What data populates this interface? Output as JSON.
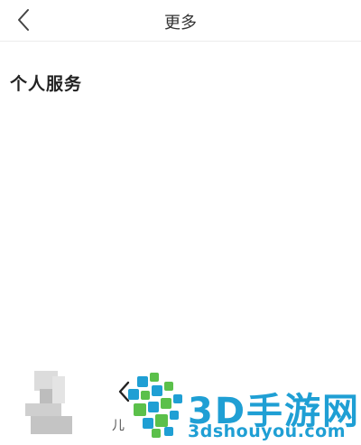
{
  "navbar": {
    "title": "更多",
    "back_icon": "chevron-left-icon"
  },
  "section": {
    "title": "个人服务"
  },
  "bottom_bar": {
    "partial_label": "儿",
    "partial_icon": "chevron-left-icon"
  },
  "watermark": {
    "brand": "3D手游网",
    "url": "3dshouyou.com",
    "colors": {
      "blue": "#1f9fd4",
      "green": "#5bc04a"
    }
  },
  "theme": {
    "background": "#ffffff",
    "text": "#222222",
    "divider": "#ececec"
  }
}
